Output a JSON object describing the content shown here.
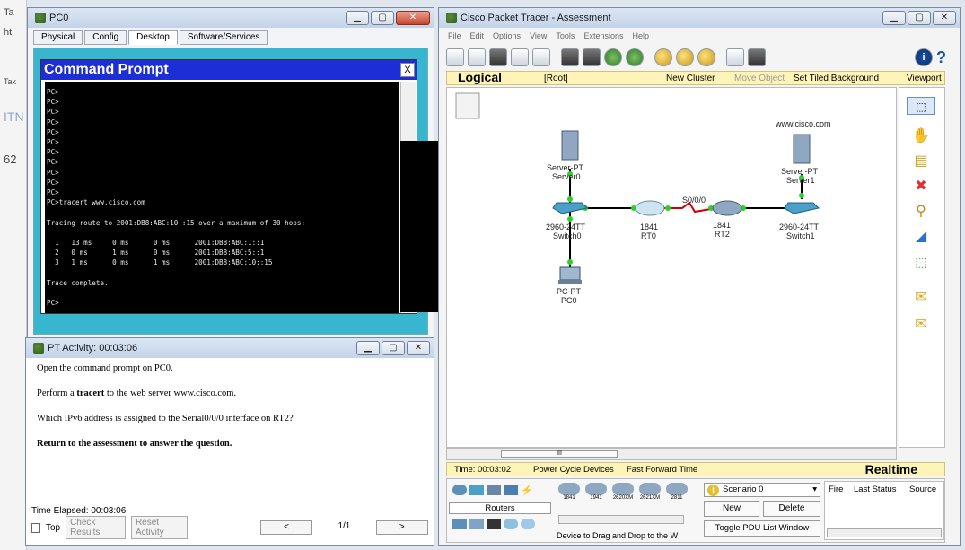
{
  "background_app": {
    "lbl1": "Ta",
    "lbl2": "ht",
    "lbl3": "Tak",
    "lbl4": "ITN",
    "lbl5": "62"
  },
  "pc0": {
    "title": "PC0",
    "tabs": [
      "Physical",
      "Config",
      "Desktop",
      "Software/Services"
    ]
  },
  "cmd": {
    "title": "Command Prompt",
    "close": "X",
    "output": "PC>\nPC>\nPC>\nPC>\nPC>\nPC>\nPC>\nPC>\nPC>\nPC>\nPC>\nPC>tracert www.cisco.com\n\nTracing route to 2001:DB8:ABC:10::15 over a maximum of 30 hops:\n\n  1   13 ms     0 ms      0 ms      2001:DB8:ABC:1::1\n  2   0 ms      1 ms      0 ms      2001:DB8:ABC:5::1\n  3   1 ms      0 ms      1 ms      2001:DB8:ABC:10::15\n\nTrace complete.\n\nPC>"
  },
  "activity": {
    "title": "PT Activity: 00:03:06",
    "line1": "Open the command prompt on PC0.",
    "line2_pre": "Perform a ",
    "line2_bold": "tracert",
    "line2_post": " to the web server www.cisco.com.",
    "line3": "Which IPv6 address is assigned to the Serial0/0/0 interface on RT2?",
    "line4": "Return to the assessment to answer the question.",
    "elapsed": "Time Elapsed: 00:03:06",
    "top": "Top",
    "check": "Check Results",
    "reset": "Reset Activity",
    "prev": "<",
    "page": "1/1",
    "next": ">"
  },
  "pt": {
    "title": "Cisco Packet Tracer - Assessment",
    "menu": [
      "File",
      "Edit",
      "Options",
      "View",
      "Tools",
      "Extensions",
      "Help"
    ],
    "logical": "Logical",
    "root": "[Root]",
    "new_cluster": "New Cluster",
    "move_object": "Move Object",
    "tiled": "Set Tiled Background",
    "viewport": "Viewport",
    "time": "Time: 00:03:02",
    "power": "Power Cycle Devices",
    "ffwd": "Fast Forward Time",
    "realtime": "Realtime",
    "routers": "Routers",
    "models": [
      "1841",
      "1941",
      "2620XM",
      "2621XM",
      "2811"
    ],
    "drag_hint": "Device to Drag and Drop to the W",
    "scenario": "Scenario 0",
    "new": "New",
    "delete": "Delete",
    "toggle": "Toggle PDU List Window",
    "cols": [
      "Fire",
      "Last Status",
      "Source"
    ],
    "scroll_marker": "III"
  },
  "topology": {
    "server0_type": "Server-PT",
    "server0_name": "Server0",
    "server1_domain": "www.cisco.com",
    "server1_type": "Server-PT",
    "server1_name": "Server1",
    "switch0_type": "2960-24TT",
    "switch0_name": "Switch0",
    "switch1_type": "2960-24TT",
    "switch1_name": "Switch1",
    "rt0_model": "1841",
    "rt0_name": "RT0",
    "rt2_model": "1841",
    "rt2_name": "RT2",
    "serial_label": "S0/0/0",
    "pc0_type": "PC-PT",
    "pc0_name": "PC0"
  }
}
